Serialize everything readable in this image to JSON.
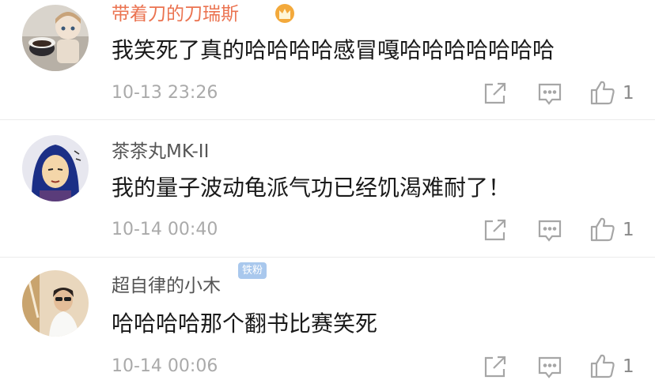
{
  "comments": [
    {
      "username": "带着刀的刀瑞斯",
      "text": "我笑死了真的哈哈哈哈感冒嘎哈哈哈哈哈哈哈",
      "time": "10-13 23:26",
      "likes": "1",
      "name_color": "#eb7350"
    },
    {
      "username": "茶茶丸MK-II",
      "badge": "铁粉",
      "text": "我的量子波动龟派气功已经饥渴难耐了！",
      "time": "10-14 00:40",
      "likes": "1"
    },
    {
      "username": "超自律的小木",
      "text": "哈哈哈哈那个翻书比赛笑死",
      "time": "10-14 00:06",
      "likes": "1"
    }
  ],
  "icons": [
    "share-icon",
    "comment-icon",
    "like-icon",
    "crown-icon"
  ]
}
